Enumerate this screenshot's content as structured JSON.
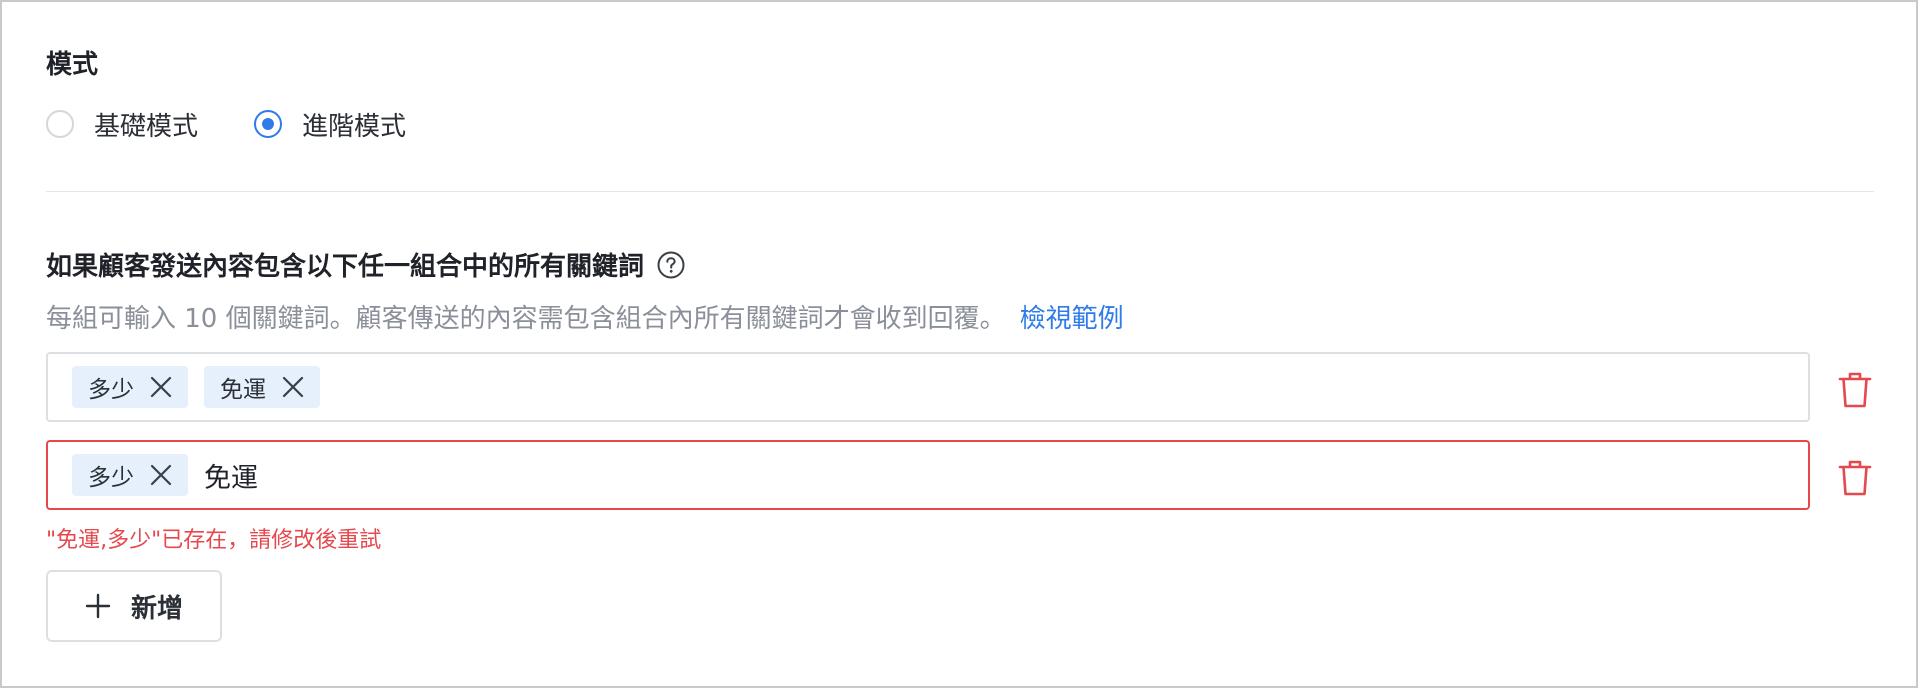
{
  "mode": {
    "title": "模式",
    "options": [
      {
        "label": "基礎模式",
        "checked": false
      },
      {
        "label": "進階模式",
        "checked": true
      }
    ]
  },
  "conditions": {
    "title": "如果顧客發送內容包含以下任一組合中的所有關鍵詞",
    "help_icon": "question-circle-icon",
    "description": "每組可輸入 10 個關鍵詞。顧客傳送的內容需包含組合內所有關鍵詞才會收到回覆。",
    "example_link": "檢視範例",
    "groups": [
      {
        "tags": [
          "多少",
          "免運"
        ],
        "input_value": "",
        "error": false
      },
      {
        "tags": [
          "多少"
        ],
        "input_value": "免運",
        "error": true
      }
    ],
    "error_message": "\"免運,多少\"已存在，請修改後重試",
    "add_button": "新增"
  },
  "colors": {
    "accent": "#2f7bea",
    "error": "#e5484d",
    "tag_bg": "#e6f0fd",
    "muted_text": "#8a8f99"
  }
}
